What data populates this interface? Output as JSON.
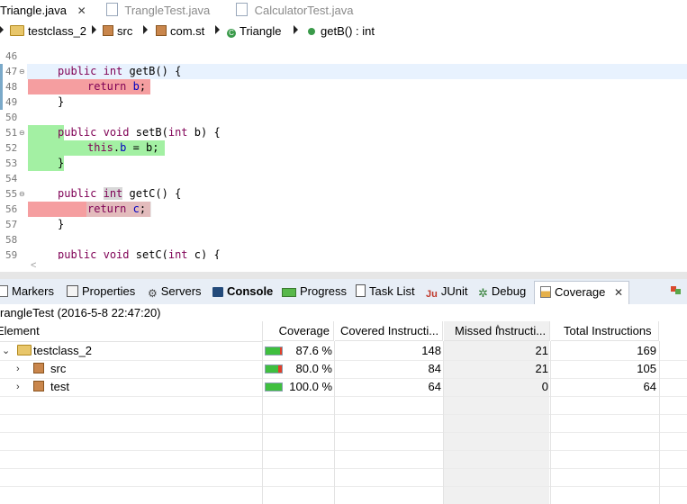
{
  "editor_tabs": [
    {
      "label": "Triangle.java",
      "active": true,
      "closable": true
    },
    {
      "label": "TrangleTest.java",
      "active": false
    },
    {
      "label": "CalculatorTest.java",
      "active": false
    }
  ],
  "breadcrumb": {
    "project": "testclass_2",
    "folder": "src",
    "package": "com.st",
    "class": "Triangle",
    "class_icon_letter": "C",
    "method": "getB() : int"
  },
  "code_lines": [
    {
      "n": "46",
      "text": ""
    },
    {
      "n": "47",
      "text": "public int getB() {"
    },
    {
      "n": "48",
      "text": "return b;"
    },
    {
      "n": "49",
      "text": "}"
    },
    {
      "n": "50",
      "text": ""
    },
    {
      "n": "51",
      "text": "public void setB(int b) {"
    },
    {
      "n": "52",
      "text": "this.b = b;"
    },
    {
      "n": "53",
      "text": "}"
    },
    {
      "n": "54",
      "text": ""
    },
    {
      "n": "55",
      "text": "public int getC() {"
    },
    {
      "n": "56",
      "text": "return c;"
    },
    {
      "n": "57",
      "text": "}"
    },
    {
      "n": "58",
      "text": ""
    },
    {
      "n": "59",
      "text": "public void setC(int c) {"
    }
  ],
  "code_tokens": {
    "public": "public",
    "int": "int",
    "void": "void",
    "return": "return",
    "this": "this",
    "getB": " getB() {",
    "setB_sig": " setB(",
    "setB_arg": " b) {",
    "b_field": "b",
    "assign": " = b;",
    "semi": ";",
    "c_field": "c",
    "getC": " getC() {",
    "setC_sig": " setC(",
    "setC_arg": " c) {",
    "close": "}"
  },
  "coverage_colors": {
    "covered": "#a3f0a3",
    "missed": "#f59ea0",
    "bar_green": "#3fbf3f",
    "bar_red": "#e0402a"
  },
  "view_tabs": [
    {
      "label": "Markers",
      "icon": "markers-icon"
    },
    {
      "label": "Properties",
      "icon": "properties-icon"
    },
    {
      "label": "Servers",
      "icon": "servers-icon"
    },
    {
      "label": "Console",
      "icon": "console-icon"
    },
    {
      "label": "Progress",
      "icon": "progress-icon"
    },
    {
      "label": "Task List",
      "icon": "task-list-icon"
    },
    {
      "label": "JUnit",
      "icon": "junit-icon"
    },
    {
      "label": "Debug",
      "icon": "debug-icon"
    },
    {
      "label": "Coverage",
      "icon": "coverage-icon",
      "active": true
    }
  ],
  "session_title": "rangleTest (2016-5-8 22:47:20)",
  "table": {
    "headers": [
      "Element",
      "Coverage",
      "Covered Instructi...",
      "Missed Instructi...",
      "Total Instructions"
    ],
    "rows": [
      {
        "element": "testclass_2",
        "coverage": "87.6 %",
        "coverage_fraction": 0.876,
        "covered": "148",
        "missed": "21",
        "total": "169",
        "expanded": true
      },
      {
        "element": "src",
        "coverage": "80.0 %",
        "coverage_fraction": 0.8,
        "covered": "84",
        "missed": "21",
        "total": "105",
        "expanded": false
      },
      {
        "element": "test",
        "coverage": "100.0 %",
        "coverage_fraction": 1.0,
        "covered": "64",
        "missed": "0",
        "total": "64",
        "expanded": false
      }
    ]
  }
}
